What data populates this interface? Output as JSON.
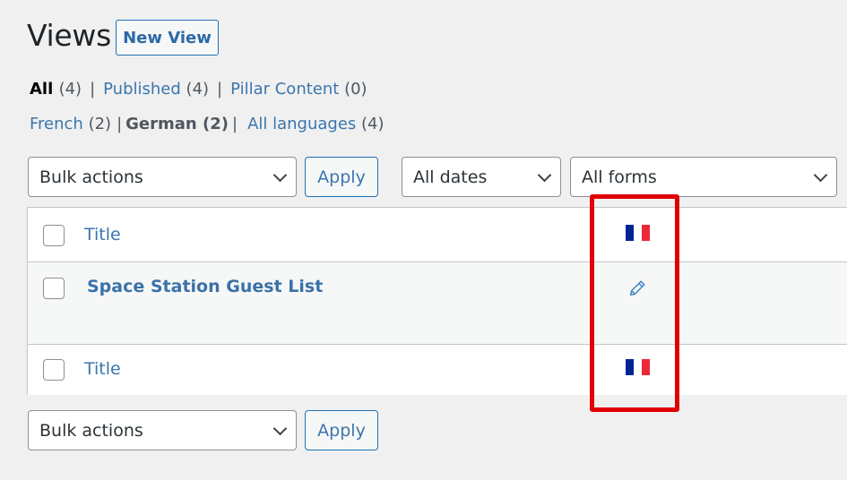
{
  "header": {
    "title": "Views",
    "new_button": "New View"
  },
  "status_filters": [
    {
      "label": "All",
      "count": "(4)",
      "current": true
    },
    {
      "label": "Published",
      "count": "(4)"
    },
    {
      "label": "Pillar Content",
      "count": "(0)"
    }
  ],
  "language_filters": [
    {
      "label": "French",
      "count": "(2)"
    },
    {
      "label": "German",
      "count": "(2)",
      "current": true
    },
    {
      "label": "All languages",
      "count": "(4)"
    }
  ],
  "separator": "|",
  "top_nav": {
    "bulk_actions": "Bulk actions",
    "apply": "Apply",
    "dates_filter": "All dates",
    "forms_filter": "All forms"
  },
  "table": {
    "column_title": "Title",
    "language_column_icon": "french-flag-icon",
    "rows": [
      {
        "title": "Space Station Guest List",
        "language_action_icon": "pencil-edit-icon"
      }
    ]
  },
  "bottom_nav": {
    "bulk_actions": "Bulk actions",
    "apply": "Apply"
  },
  "colors": {
    "link": "#3b76ad",
    "primary_border": "#2271b1",
    "highlight": "#e00000",
    "flag_blue": "#002395",
    "flag_white": "#ffffff",
    "flag_red": "#ed2939"
  }
}
